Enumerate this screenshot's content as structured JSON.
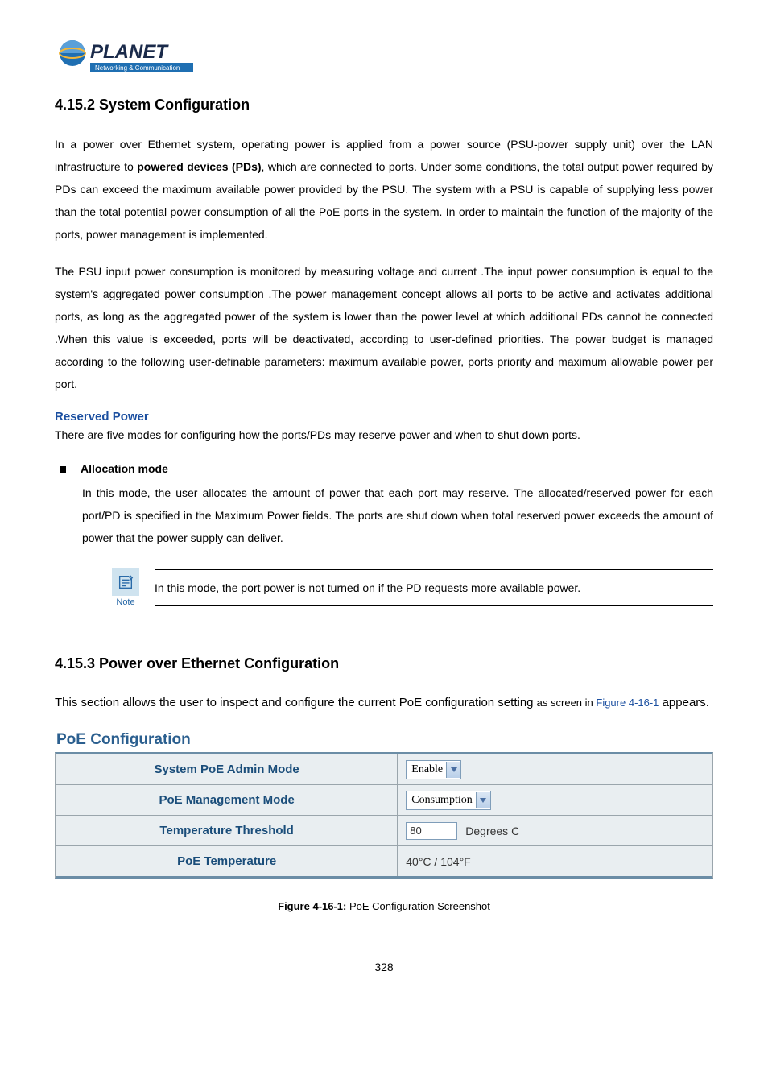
{
  "logo": {
    "brand": "PLANET",
    "tagline": "Networking & Communication"
  },
  "section1": {
    "heading": "4.15.2 System Configuration",
    "para1_a": "In a power over Ethernet system, operating power is applied from a power source (PSU-power supply unit) over the LAN infrastructure to ",
    "para1_bold": "powered devices (PDs)",
    "para1_b": ", which are connected to ports. Under some conditions, the total output power required by PDs can exceed the maximum available power provided by the PSU. The system with a PSU is capable of supplying less power than the total potential power consumption of all the PoE ports in the system. In order to maintain the function of the majority of the ports, power management is implemented.",
    "para2": "The PSU input power consumption is monitored by measuring voltage and current .The input power consumption is equal to the system's aggregated power consumption .The power management concept allows all ports to be active and activates additional ports, as long as the aggregated power of the system is lower than the power level at which additional PDs cannot be connected .When this value is exceeded, ports will be deactivated, according to user-defined priorities. The power budget is managed according to the following user-definable parameters: maximum available power, ports priority and maximum allowable power per port.",
    "reserved_head": "Reserved Power",
    "reserved_line": "There are five modes for configuring how the ports/PDs may reserve power and when to shut down ports.",
    "bullet_title": "Allocation mode",
    "bullet_body": "In this mode, the user allocates the amount of power that each port may reserve. The allocated/reserved power for each port/PD is specified in the Maximum Power fields. The ports are shut down when total reserved power exceeds the amount of power that the power supply can deliver.",
    "note_label": "Note",
    "note_text": "In this mode, the port power is not turned on if the PD requests more available power."
  },
  "section2": {
    "heading": "4.15.3 Power over Ethernet Configuration",
    "intro_a": "This section allows the user to inspect and configure the current PoE configuration setting ",
    "intro_small": "as screen in ",
    "intro_link": "Figure 4-16-1",
    "intro_b": "appears.",
    "panel_title": "PoE Configuration",
    "rows": {
      "r0": {
        "label": "System PoE Admin Mode",
        "value": "Enable"
      },
      "r1": {
        "label": "PoE Management Mode",
        "value": "Consumption"
      },
      "r2": {
        "label": "Temperature Threshold",
        "value": "80",
        "unit": "Degrees C"
      },
      "r3": {
        "label": "PoE Temperature",
        "value": "40°C / 104°F"
      }
    },
    "caption_b": "Figure 4-16-1:",
    "caption_r": " PoE Configuration Screenshot"
  },
  "page_number": "328"
}
